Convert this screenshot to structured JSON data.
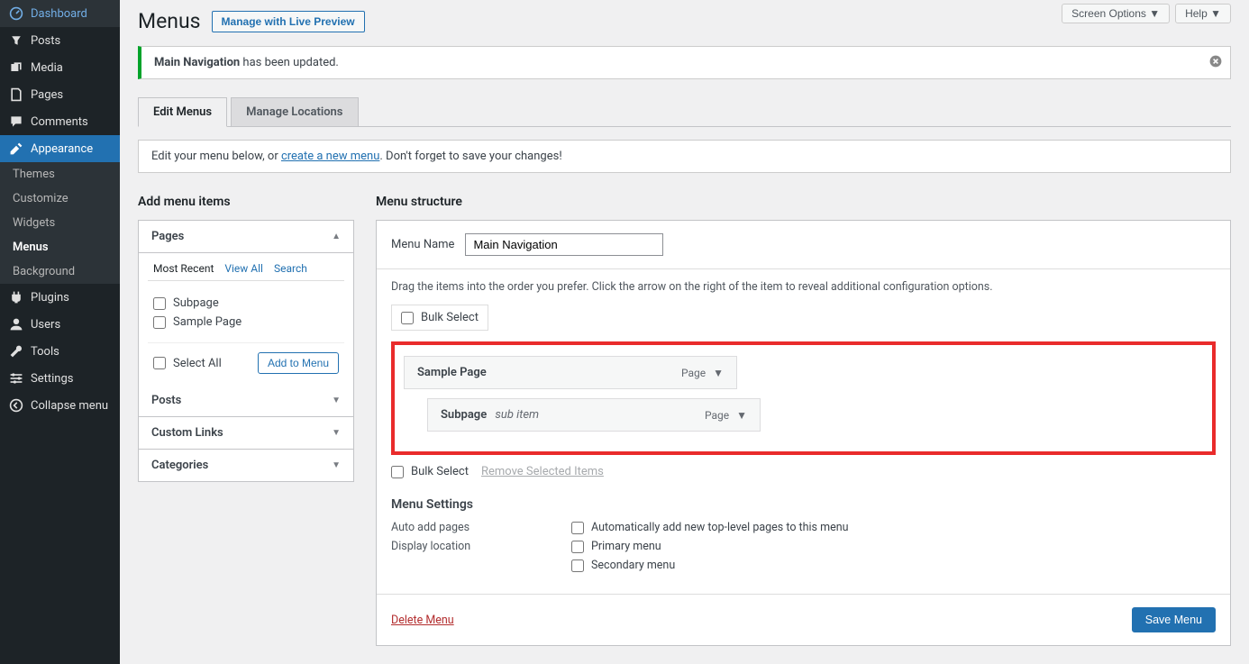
{
  "sidebar": {
    "items": [
      {
        "label": "Dashboard",
        "icon": "dashboard"
      },
      {
        "label": "Posts",
        "icon": "pin"
      },
      {
        "label": "Media",
        "icon": "media"
      },
      {
        "label": "Pages",
        "icon": "pages"
      },
      {
        "label": "Comments",
        "icon": "comments"
      },
      {
        "label": "Appearance",
        "icon": "appearance",
        "active": true
      },
      {
        "label": "Plugins",
        "icon": "plugins"
      },
      {
        "label": "Users",
        "icon": "users"
      },
      {
        "label": "Tools",
        "icon": "tools"
      },
      {
        "label": "Settings",
        "icon": "settings"
      },
      {
        "label": "Collapse menu",
        "icon": "collapse"
      }
    ],
    "subitems": [
      {
        "label": "Themes"
      },
      {
        "label": "Customize"
      },
      {
        "label": "Widgets"
      },
      {
        "label": "Menus",
        "current": true
      },
      {
        "label": "Background"
      }
    ]
  },
  "topbar": {
    "screen_options": "Screen Options",
    "help": "Help"
  },
  "header": {
    "title": "Menus",
    "live_preview": "Manage with Live Preview"
  },
  "notice": {
    "bold": "Main Navigation",
    "rest": " has been updated."
  },
  "tabs": {
    "edit": "Edit Menus",
    "locations": "Manage Locations"
  },
  "edit_hint": {
    "pre": "Edit your menu below, or ",
    "link": "create a new menu",
    "post": ". Don't forget to save your changes!"
  },
  "left": {
    "title": "Add menu items",
    "accordion": {
      "pages": "Pages",
      "posts": "Posts",
      "custom_links": "Custom Links",
      "categories": "Categories"
    },
    "subtabs": {
      "recent": "Most Recent",
      "view_all": "View All",
      "search": "Search"
    },
    "page_items": [
      "Subpage",
      "Sample Page"
    ],
    "select_all": "Select All",
    "add_to_menu": "Add to Menu"
  },
  "right": {
    "title": "Menu structure",
    "menu_name_label": "Menu Name",
    "menu_name_value": "Main Navigation",
    "drag_hint": "Drag the items into the order you prefer. Click the arrow on the right of the item to reveal additional configuration options.",
    "bulk_select": "Bulk Select",
    "remove_selected": "Remove Selected Items",
    "menu_items": [
      {
        "title": "Sample Page",
        "type": "Page"
      },
      {
        "title": "Subpage",
        "sub": "sub item",
        "type": "Page",
        "indent": true
      }
    ],
    "settings_title": "Menu Settings",
    "auto_add_label": "Auto add pages",
    "auto_add_opt": "Automatically add new top-level pages to this menu",
    "display_label": "Display location",
    "loc1": "Primary menu",
    "loc2": "Secondary menu",
    "delete": "Delete Menu",
    "save": "Save Menu"
  }
}
